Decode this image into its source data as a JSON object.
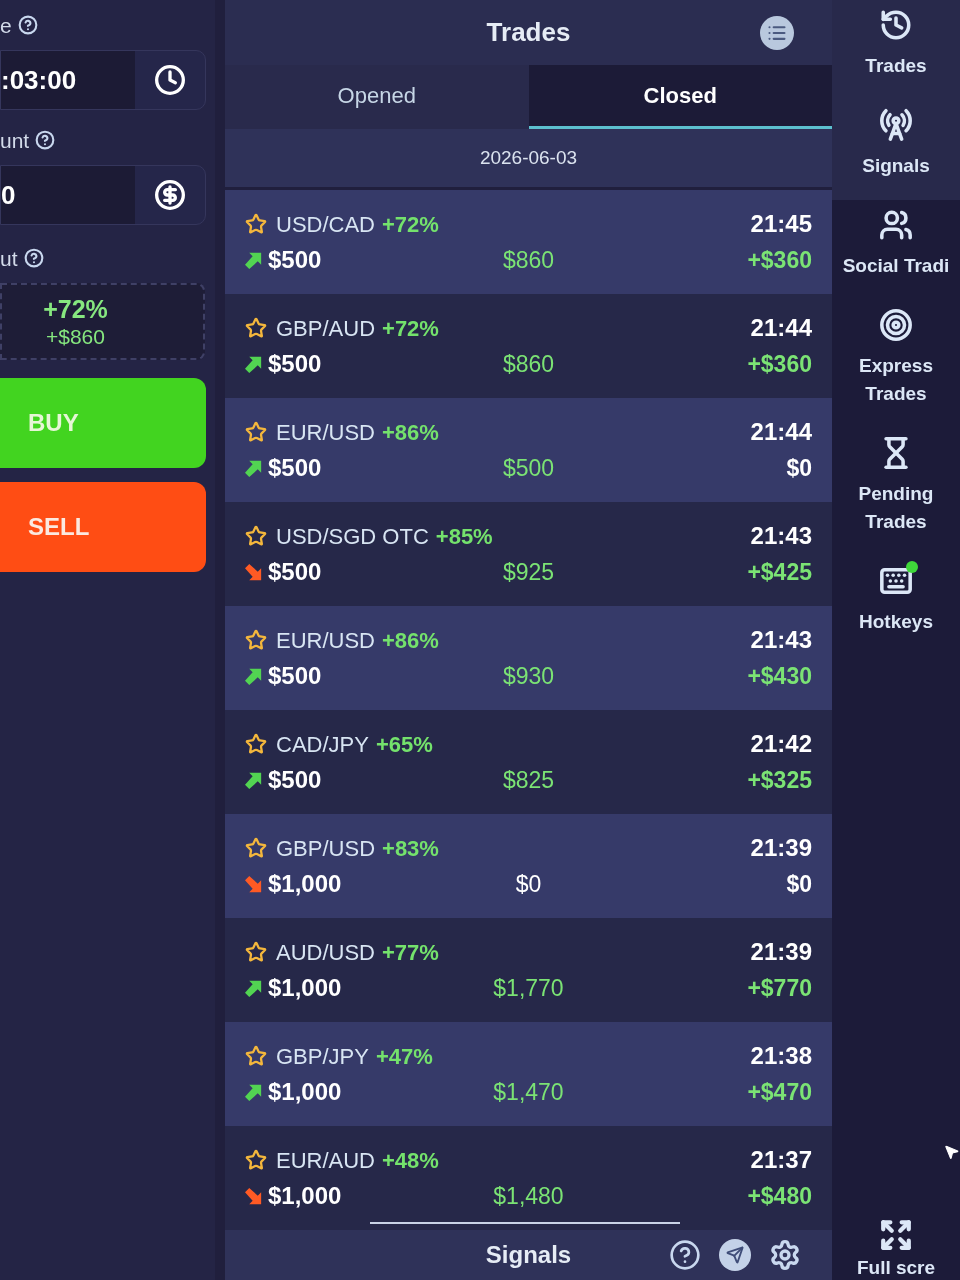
{
  "trade_settings": {
    "time": {
      "label": "e",
      "value": ":03:00"
    },
    "amount": {
      "label": "unt",
      "value": "0"
    },
    "payout": {
      "label": "ut",
      "percent": "+72%",
      "profit": "+$860"
    },
    "buttons": [
      {
        "label": "BUY",
        "kind": "buy"
      },
      {
        "label": "SELL",
        "kind": "sell"
      }
    ]
  },
  "trades_panel": {
    "title": "Trades",
    "tabs": [
      {
        "label": "Opened",
        "selected": false
      },
      {
        "label": "Closed",
        "selected": true
      }
    ],
    "date": "2026-06-03",
    "trades": [
      {
        "pair": "USD/CAD",
        "percent": "+72%",
        "time": "21:45",
        "up": true,
        "amount": "$500",
        "payout": "$860",
        "profit": "+$360",
        "payout_positive": true,
        "profit_positive": true
      },
      {
        "pair": "GBP/AUD",
        "percent": "+72%",
        "time": "21:44",
        "up": true,
        "amount": "$500",
        "payout": "$860",
        "profit": "+$360",
        "payout_positive": true,
        "profit_positive": true
      },
      {
        "pair": "EUR/USD",
        "percent": "+86%",
        "time": "21:44",
        "up": true,
        "amount": "$500",
        "payout": "$500",
        "profit": "$0",
        "payout_positive": true,
        "profit_positive": false
      },
      {
        "pair": "USD/SGD OTC",
        "percent": "+85%",
        "time": "21:43",
        "up": false,
        "amount": "$500",
        "payout": "$925",
        "profit": "+$425",
        "payout_positive": true,
        "profit_positive": true
      },
      {
        "pair": "EUR/USD",
        "percent": "+86%",
        "time": "21:43",
        "up": true,
        "amount": "$500",
        "payout": "$930",
        "profit": "+$430",
        "payout_positive": true,
        "profit_positive": true
      },
      {
        "pair": "CAD/JPY",
        "percent": "+65%",
        "time": "21:42",
        "up": true,
        "amount": "$500",
        "payout": "$825",
        "profit": "+$325",
        "payout_positive": true,
        "profit_positive": true
      },
      {
        "pair": "GBP/USD",
        "percent": "+83%",
        "time": "21:39",
        "up": false,
        "amount": "$1,000",
        "payout": "$0",
        "profit": "$0",
        "payout_positive": false,
        "profit_positive": false
      },
      {
        "pair": "AUD/USD",
        "percent": "+77%",
        "time": "21:39",
        "up": true,
        "amount": "$1,000",
        "payout": "$1,770",
        "profit": "+$770",
        "payout_positive": true,
        "profit_positive": true
      },
      {
        "pair": "GBP/JPY",
        "percent": "+47%",
        "time": "21:38",
        "up": true,
        "amount": "$1,000",
        "payout": "$1,470",
        "profit": "+$470",
        "payout_positive": true,
        "profit_positive": true
      },
      {
        "pair": "EUR/AUD",
        "percent": "+48%",
        "time": "21:37",
        "up": false,
        "amount": "$1,000",
        "payout": "$1,480",
        "profit": "+$480",
        "payout_positive": true,
        "profit_positive": true
      }
    ]
  },
  "signals_panel": {
    "title": "Signals"
  },
  "sidebar": {
    "items": [
      {
        "label": "Trades",
        "highlighted": true,
        "dot": false
      },
      {
        "label": "Signals",
        "highlighted": true,
        "dot": false
      },
      {
        "label": "Social Tradi",
        "highlighted": false,
        "dot": false
      },
      {
        "label": "Express Trades",
        "highlighted": false,
        "dot": false
      },
      {
        "label": "Pending Trades",
        "highlighted": false,
        "dot": false
      },
      {
        "label": "Hotkeys",
        "highlighted": false,
        "dot": true
      }
    ],
    "fullscreen": {
      "label": "Full scre"
    }
  }
}
